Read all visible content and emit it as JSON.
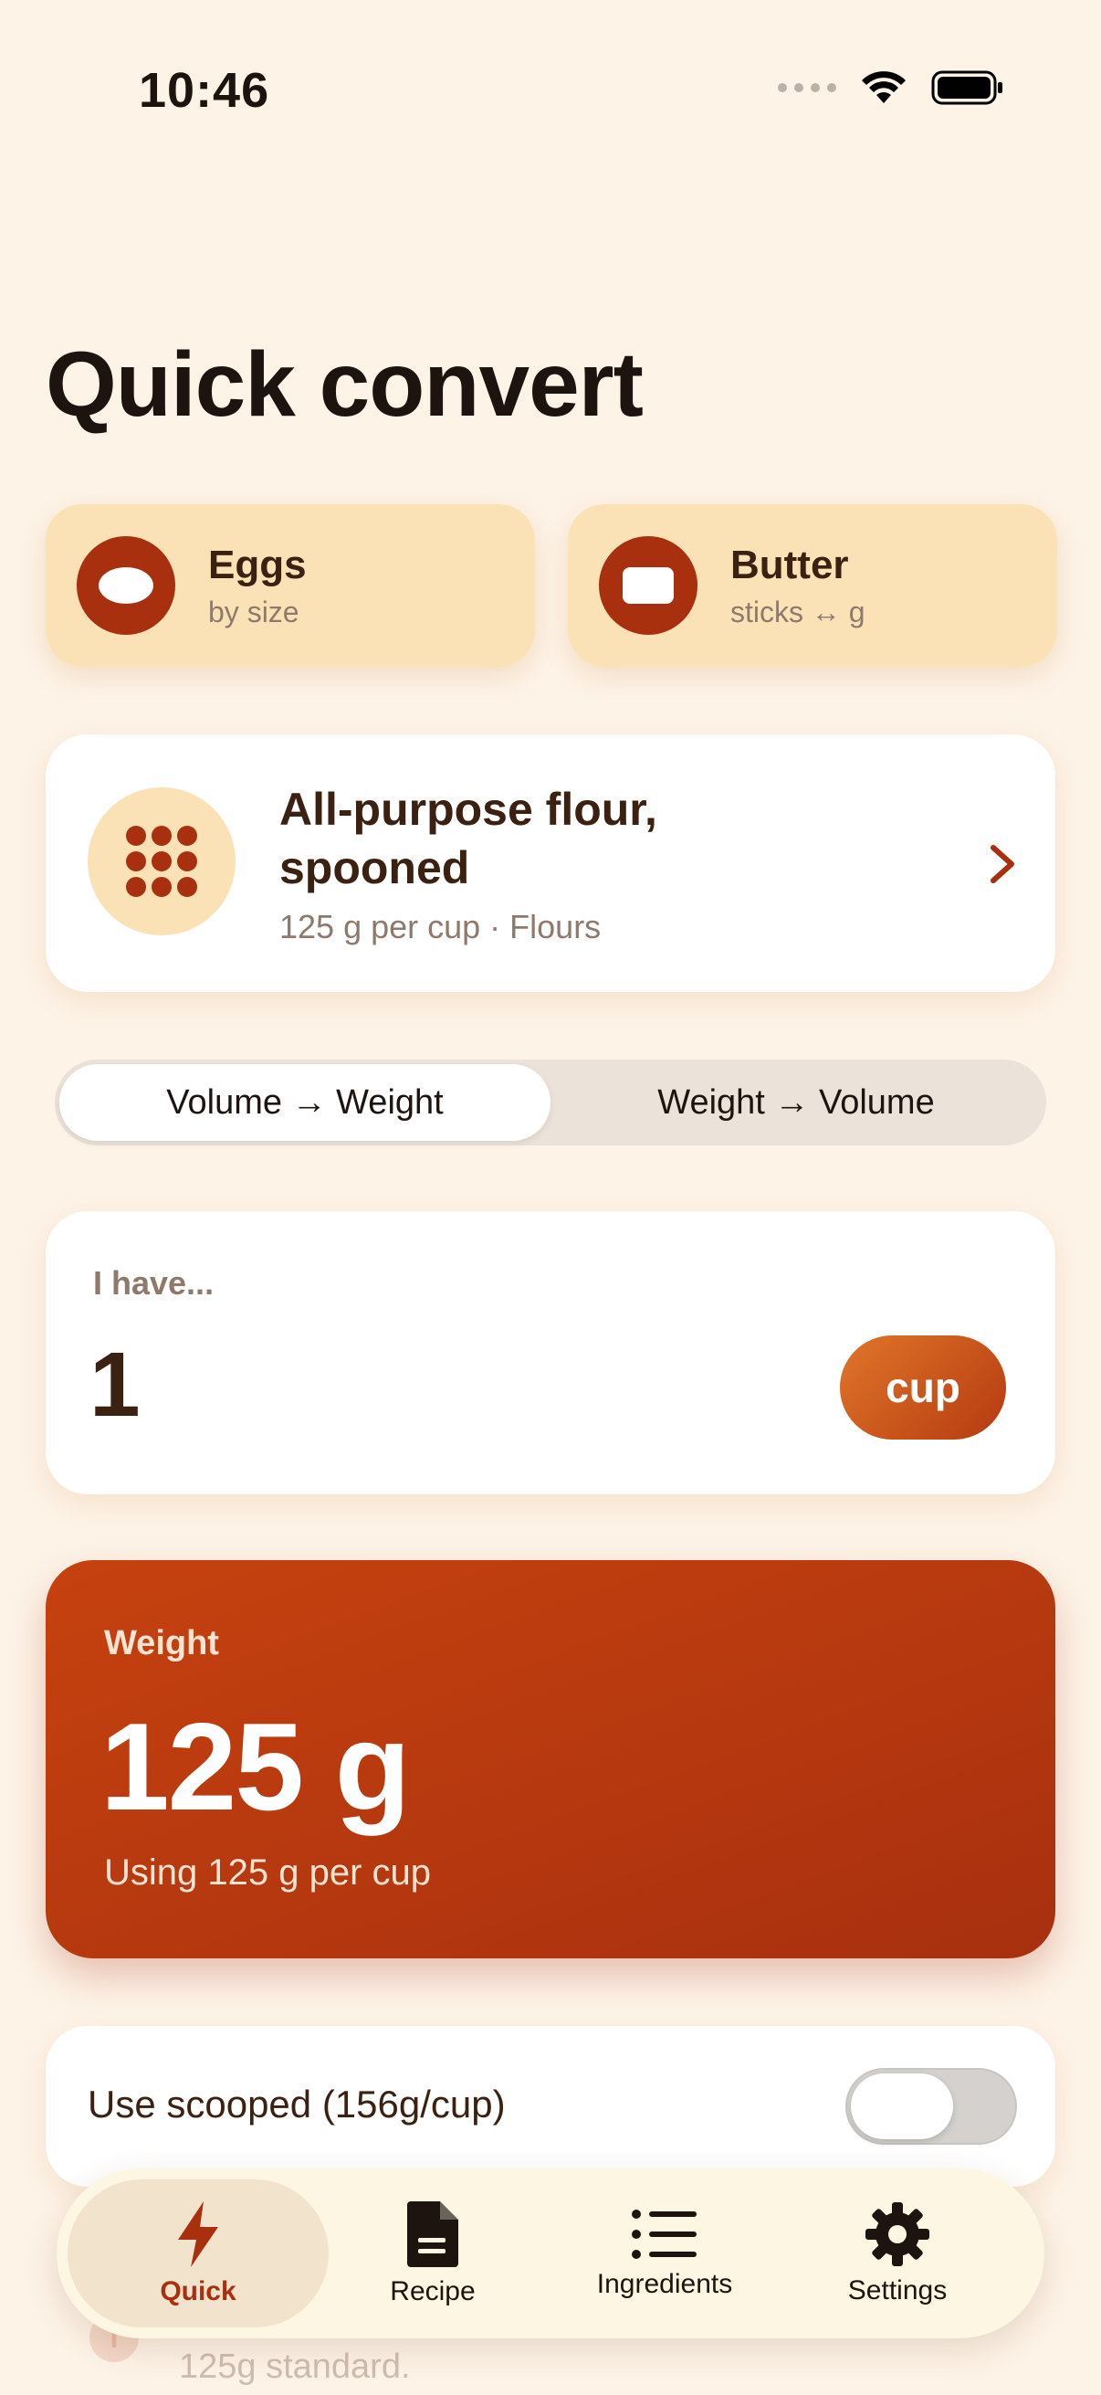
{
  "status_bar": {
    "time": "10:46"
  },
  "page": {
    "title": "Quick convert"
  },
  "quick_tiles": [
    {
      "title": "Eggs",
      "subtitle": "by size",
      "icon": "egg-icon"
    },
    {
      "title": "Butter",
      "subtitle": "sticks ↔ g",
      "icon": "butter-icon"
    }
  ],
  "ingredient": {
    "name": "All-purpose flour, spooned",
    "detail": "125 g per cup · Flours",
    "icon": "flour-dots-icon"
  },
  "mode": {
    "options": [
      "Volume → Weight",
      "Weight → Volume"
    ],
    "selected": "Volume → Weight"
  },
  "input": {
    "label": "I have...",
    "value": "1",
    "unit": "cup"
  },
  "result": {
    "label": "Weight",
    "value": "125 g",
    "note": "Using 125 g per cup"
  },
  "scooped_toggle": {
    "label": "Use scooped (156g/cup)",
    "on": false
  },
  "footnote": {
    "icon_text": "i",
    "text": "125g standard."
  },
  "tabs": [
    {
      "label": "Quick",
      "icon": "bolt-icon",
      "active": true
    },
    {
      "label": "Recipe",
      "icon": "document-icon",
      "active": false
    },
    {
      "label": "Ingredients",
      "icon": "list-icon",
      "active": false
    },
    {
      "label": "Settings",
      "icon": "gear-icon",
      "active": false
    }
  ],
  "colors": {
    "background": "#fdf3e7",
    "accent": "#a8300f",
    "tile": "#fbe2b6",
    "text_primary": "#3a2112",
    "text_secondary": "#8d7a6c"
  }
}
